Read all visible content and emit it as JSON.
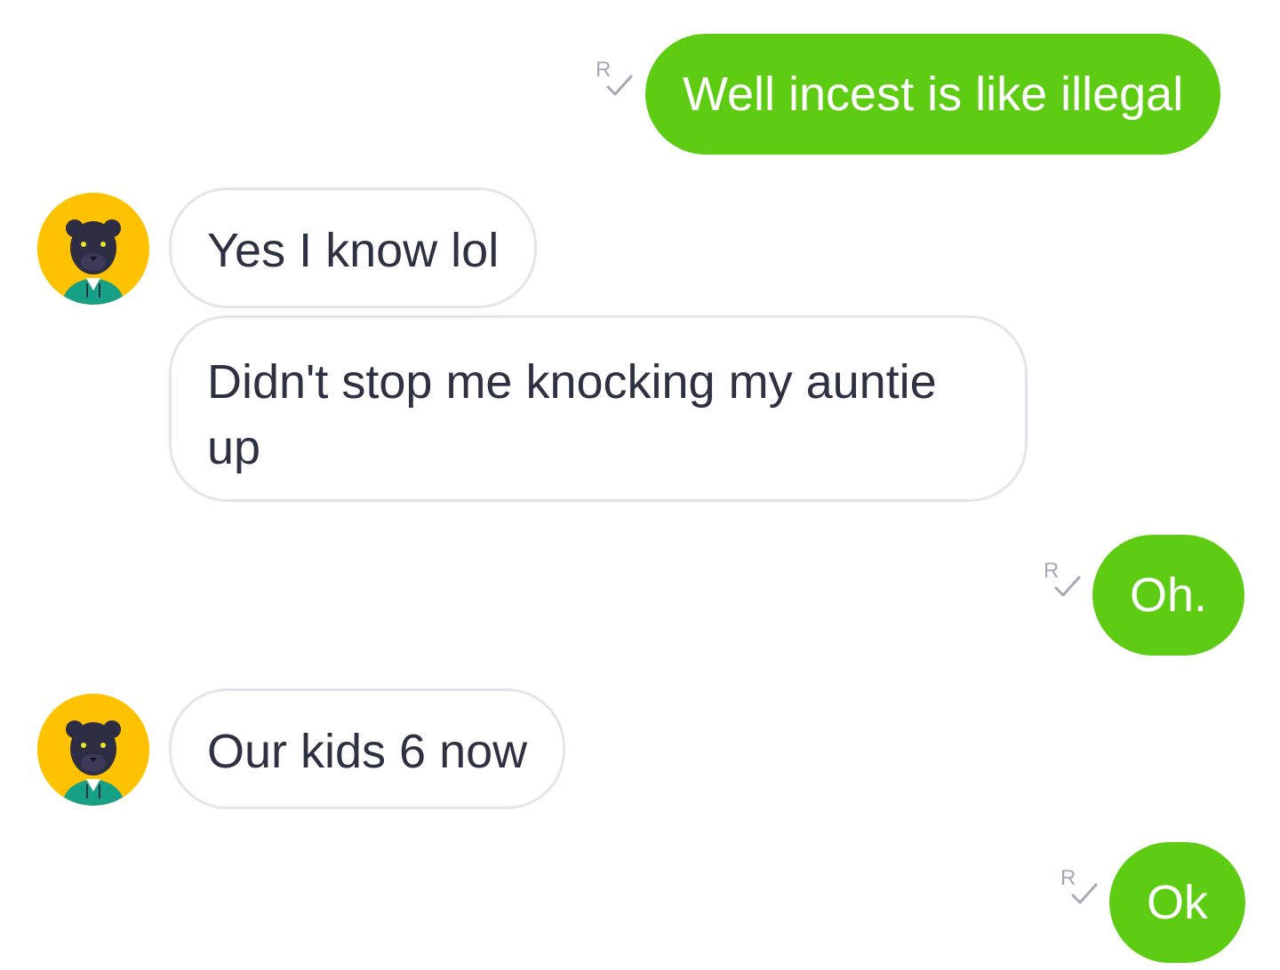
{
  "messages": [
    {
      "direction": "outgoing",
      "text": "Well incest is like illegal",
      "receipt": "R"
    },
    {
      "direction": "incoming",
      "text": "Yes I know lol"
    },
    {
      "direction": "incoming",
      "text": "Didn't stop me knocking my auntie up"
    },
    {
      "direction": "outgoing",
      "text": "Oh.",
      "receipt": "R"
    },
    {
      "direction": "incoming",
      "text": "Our kids 6 now"
    },
    {
      "direction": "outgoing",
      "text": "Ok",
      "receipt": "R"
    }
  ],
  "colors": {
    "outgoing_bubble": "#5fcc14",
    "incoming_border": "#e4e4ea",
    "incoming_text": "#2e3142",
    "avatar_bg": "#ffc200",
    "receipt_icon": "#a6a8b8"
  },
  "avatar": {
    "icon": "panther-avatar-icon"
  }
}
